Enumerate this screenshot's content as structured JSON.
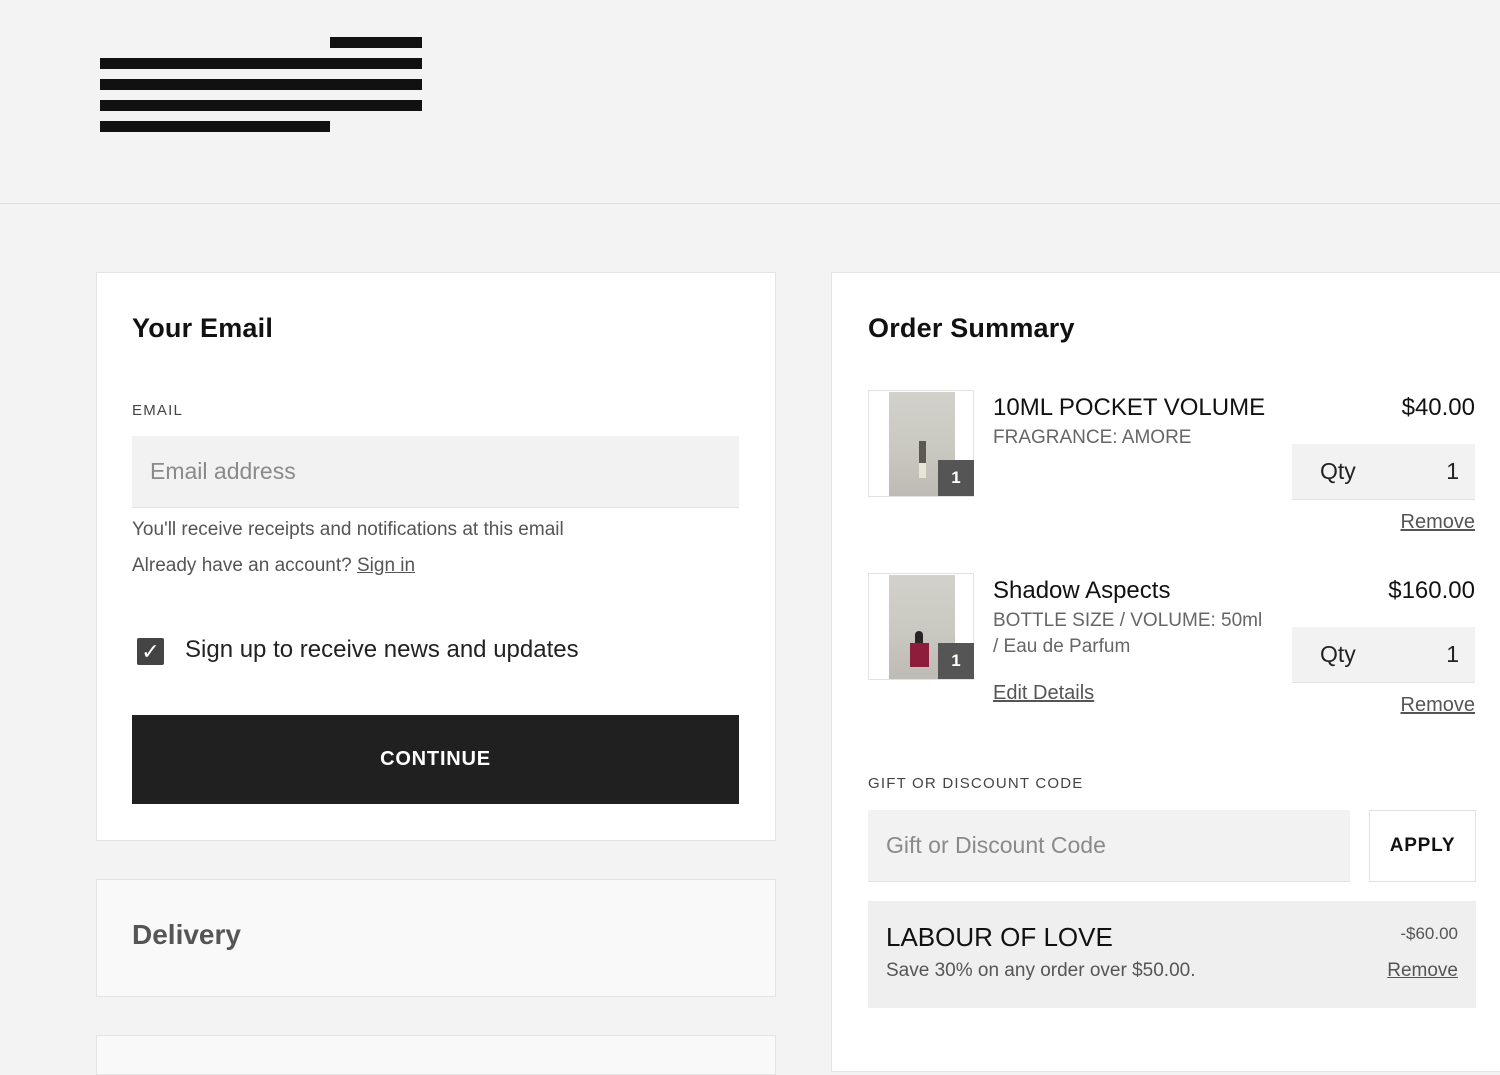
{
  "email_section": {
    "title": "Your Email",
    "email_label": "EMAIL",
    "email_placeholder": "Email address",
    "email_value": "",
    "receipt_note": "You'll receive receipts and notifications at this email",
    "account_prompt": "Already have an account?",
    "sign_in_link": "Sign in",
    "newsletter_checked": true,
    "newsletter_label": "Sign up to receive news and updates",
    "continue_label": "CONTINUE"
  },
  "delivery_section": {
    "title": "Delivery"
  },
  "order_summary": {
    "title": "Order Summary",
    "items": [
      {
        "name": "10ML POCKET VOLUME",
        "variant_line1": "FRAGRANCE: AMORE",
        "variant_line2": "",
        "price": "$40.00",
        "qty_label": "Qty",
        "qty": "1",
        "badge": "1",
        "remove_label": "Remove",
        "edit_label": ""
      },
      {
        "name": "Shadow Aspects",
        "variant_line1": "BOTTLE SIZE / VOLUME: 50ml",
        "variant_line2": "/ Eau de Parfum",
        "price": "$160.00",
        "qty_label": "Qty",
        "qty": "1",
        "badge": "1",
        "remove_label": "Remove",
        "edit_label": "Edit Details"
      }
    ],
    "discount_label": "GIFT OR DISCOUNT CODE",
    "discount_placeholder": "Gift or Discount Code",
    "apply_label": "APPLY",
    "promo": {
      "title": "LABOUR OF LOVE",
      "description": "Save 30% on any order over $50.00.",
      "amount": "-$60.00",
      "remove_label": "Remove"
    }
  },
  "colors": {
    "page_background": "#f3f3f3",
    "button_dark": "#202020",
    "card_background": "#ffffff"
  }
}
